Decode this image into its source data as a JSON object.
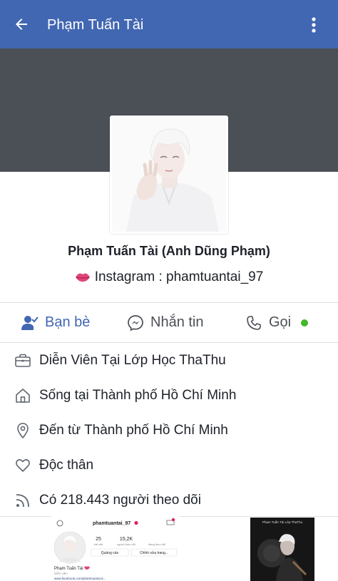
{
  "header": {
    "title": "Phạm Tuấn Tài",
    "back_icon": "arrow-left-icon",
    "more_icon": "kebab-menu-icon"
  },
  "profile": {
    "name": "Phạm Tuấn Tài (Anh Dũng Phạm)",
    "bio": "Instagram : phamtuantai_97",
    "bio_icon": "kiss-lips-icon"
  },
  "actions": {
    "friends": "Bạn bè",
    "message": "Nhắn tin",
    "call": "Gọi"
  },
  "info": [
    {
      "icon": "briefcase-icon",
      "text": "Diễn Viên Tại Lớp Học ThaThu"
    },
    {
      "icon": "home-icon",
      "text": "Sống tại Thành phố Hồ Chí Minh"
    },
    {
      "icon": "location-pin-icon",
      "text": "Đến từ Thành phố Hồ Chí Minh"
    },
    {
      "icon": "heart-icon",
      "text": "Độc thân"
    },
    {
      "icon": "rss-icon",
      "text": "Có 218.443 người theo dõi"
    }
  ],
  "thumb_instagram": {
    "username": "phamtuantai_97",
    "posts": "25",
    "posts_label": "bài viết",
    "followers": "15,2K",
    "followers_label": "người theo dõi",
    "following_label": "đang theo dõi",
    "ads_button": "Quảng cáo",
    "edit_button": "Chỉnh sửa trang...",
    "display_name": "Phạm Tuấn Tài",
    "category": "Diễn viên",
    "link": "www.facebook.com/phamtuantai.9..."
  },
  "thumb_video": {
    "caption": "Phạm Tuấn Tài Lớp ThaThu"
  },
  "colors": {
    "brand": "#4267b2",
    "cover": "#4b4f56",
    "online": "#42b72a",
    "lips": "#e0457b"
  }
}
